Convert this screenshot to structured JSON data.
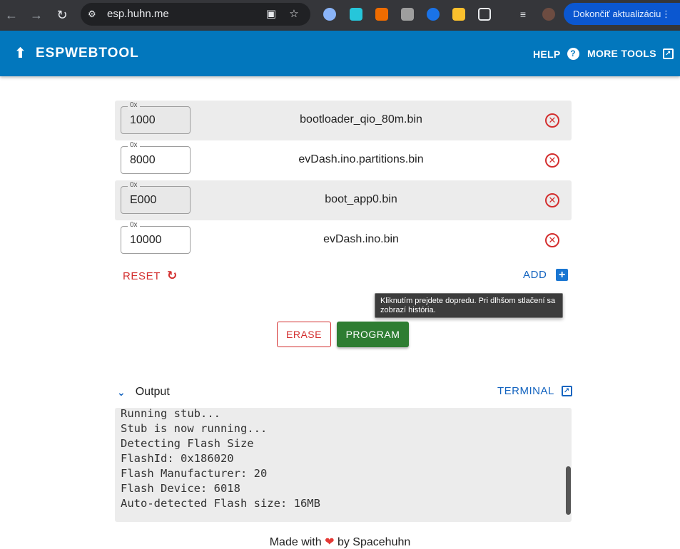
{
  "browser": {
    "url": "esp.huhn.me",
    "update_label": "Dokončiť aktualizáciu",
    "more_dots": "⋮"
  },
  "header": {
    "title": "ESPWEBTOOL",
    "help_label": "HELP",
    "more_tools_label": "MORE TOOLS"
  },
  "files": [
    {
      "offset_prefix": "0x",
      "offset": "1000",
      "name": "bootloader_qio_80m.bin"
    },
    {
      "offset_prefix": "0x",
      "offset": "8000",
      "name": "evDash.ino.partitions.bin"
    },
    {
      "offset_prefix": "0x",
      "offset": "E000",
      "name": "boot_app0.bin"
    },
    {
      "offset_prefix": "0x",
      "offset": "10000",
      "name": "evDash.ino.bin"
    }
  ],
  "actions": {
    "reset_label": "RESET",
    "add_label": "ADD",
    "erase_label": "ERASE",
    "program_label": "PROGRAM"
  },
  "tooltip": {
    "text": "Kliknutím prejdete dopredu. Pri dlhšom stlačení sa zobrazí história."
  },
  "output": {
    "title": "Output",
    "terminal_label": "TERMINAL",
    "lines": [
      "Running stub...",
      "Stub is now running...",
      "Detecting Flash Size",
      "FlashId: 0x186020",
      "Flash Manufacturer: 20",
      "Flash Device: 6018",
      "Auto-detected Flash size: 16MB"
    ]
  },
  "footer": {
    "prefix": "Made with",
    "suffix": "by Spacehuhn"
  },
  "colors": {
    "brand": "#0277bd",
    "danger": "#d32f2f",
    "success": "#2e7d32",
    "link": "#1565c0"
  }
}
